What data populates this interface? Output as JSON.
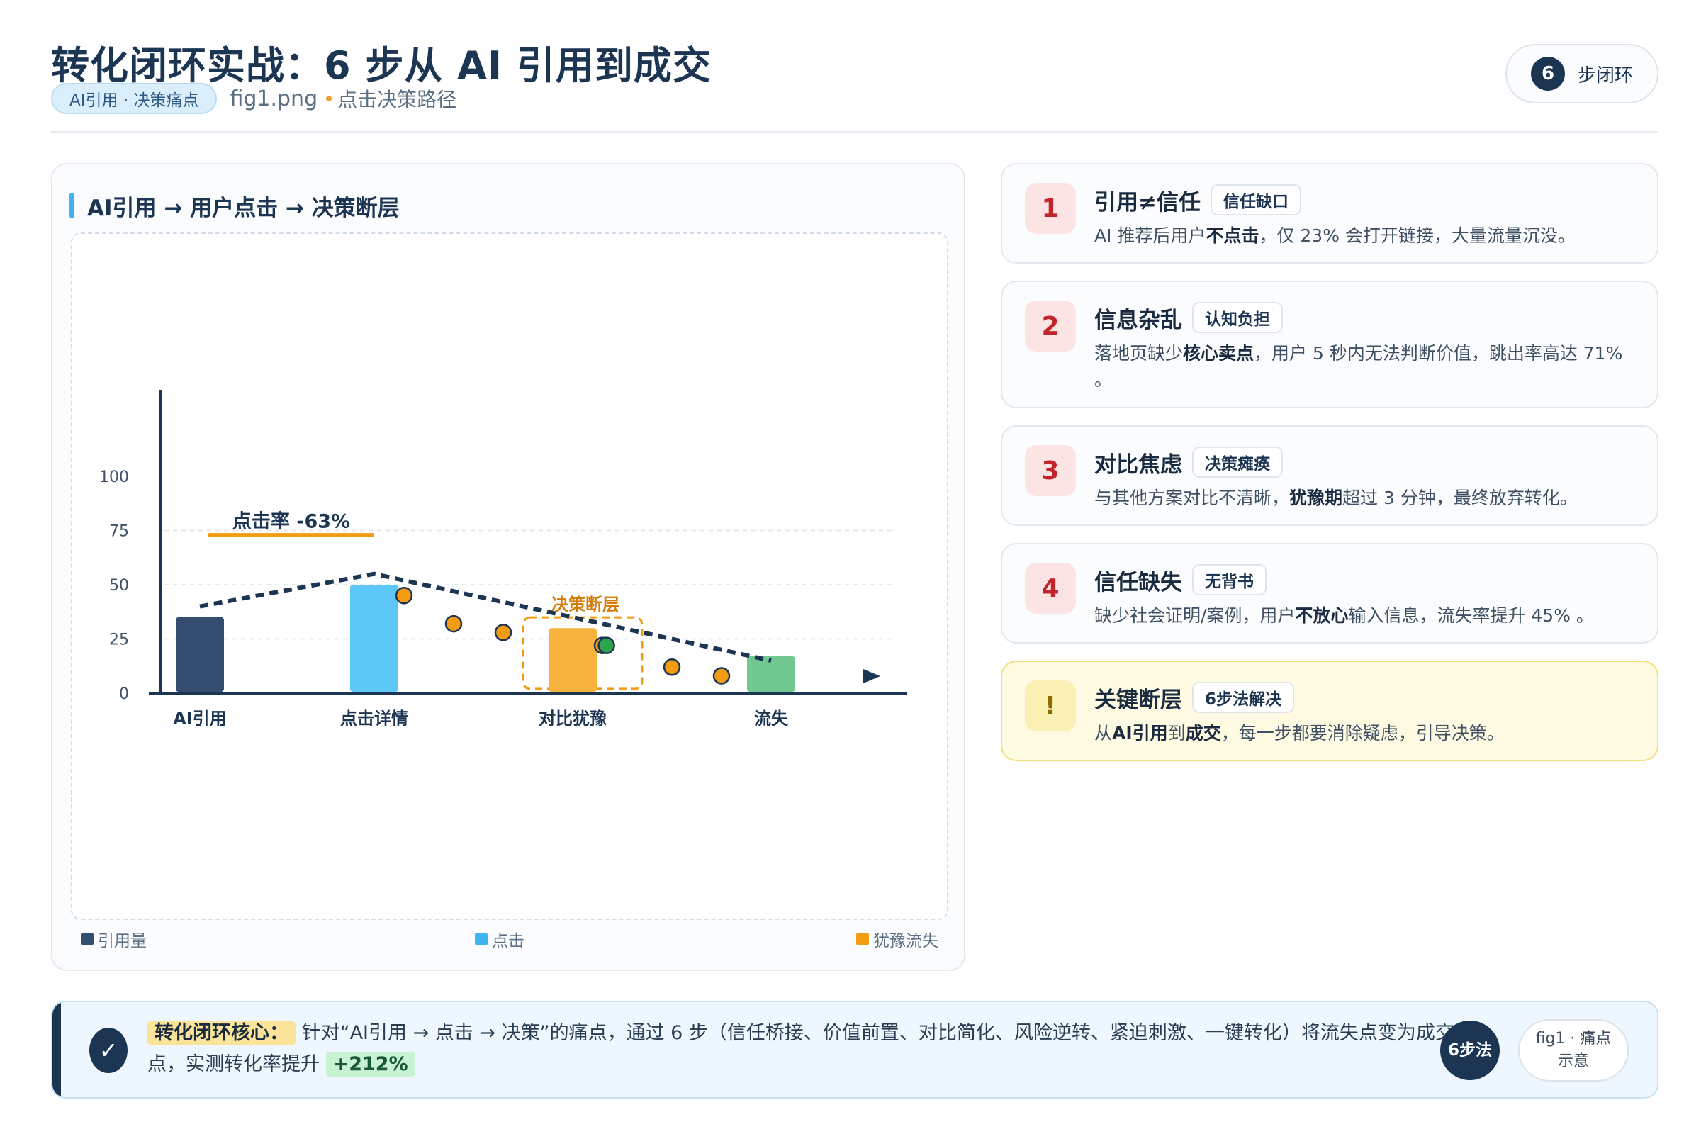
{
  "header": {
    "title": "转化闭环实战：6 步从 AI 引用到成交",
    "tag": "AI引用 · 决策痛点",
    "fig_name": "fig1.png",
    "fig_caption": "点击决策路径",
    "steps_number": "6",
    "steps_label": "步闭环"
  },
  "chart_card": {
    "title": "AI引用 → 用户点击 → 决策断层"
  },
  "chart_data": {
    "type": "bar",
    "categories": [
      "AI引用",
      "点击详情",
      "对比犹豫",
      "流失"
    ],
    "values": [
      35,
      50,
      30,
      17
    ],
    "bar_colors": [
      "#344d6e",
      "#5dc8f7",
      "#f8b23e",
      "#72c990"
    ],
    "ylim": [
      0,
      100
    ],
    "yticks": [
      0,
      25,
      50,
      75,
      100
    ],
    "trend_line": [
      [
        0,
        40
      ],
      [
        1,
        55
      ],
      [
        3,
        15
      ]
    ],
    "scatter_points": [
      [
        1.15,
        45
      ],
      [
        1.4,
        32
      ],
      [
        1.65,
        28
      ],
      [
        2.15,
        22
      ],
      [
        2.5,
        12
      ],
      [
        2.75,
        8
      ]
    ],
    "highlight_point": [
      2.17,
      22
    ],
    "annotations": {
      "click_rate": "点击率 -63%",
      "decision_gap": "决策断层"
    },
    "legend": [
      {
        "label": "引用量",
        "color": "#344d6e"
      },
      {
        "label": "点击",
        "color": "#3fb5f0"
      },
      {
        "label": "犹豫流失",
        "color": "#f39c12"
      }
    ],
    "grid": true,
    "legend_position": "bottom"
  },
  "cards": [
    {
      "number": "1",
      "title": "引用≠信任",
      "badge": "信任缺口",
      "desc_html": "AI 推荐后用户<b>不点击</b>，仅 23% 会打开链接，大量流量沉没。"
    },
    {
      "number": "2",
      "title": "信息杂乱",
      "badge": "认知负担",
      "desc_html": "落地页缺少<b>核心卖点</b>，用户 5 秒内无法判断价值，跳出率高达 71% 。"
    },
    {
      "number": "3",
      "title": "对比焦虑",
      "badge": "决策瘫痪",
      "desc_html": "与其他方案对比不清晰，<b>犹豫期</b>超过 3 分钟，最终放弃转化。"
    },
    {
      "number": "4",
      "title": "信任缺失",
      "badge": "无背书",
      "desc_html": "缺少社会证明/案例，用户<b>不放心</b>输入信息，流失率提升 45% 。"
    },
    {
      "number": "!",
      "title": "关键断层",
      "badge": "6步法解决",
      "desc_html": "从<b>AI引用</b>到<b>成交</b>，每一步都要消除疑虑，引导决策。"
    }
  ],
  "banner": {
    "check": "✓",
    "core_label": "转化闭环核心：",
    "text": "针对“AI引用 → 点击 → 决策”的痛点，通过 6 步（信任桥接、价值前置、对比简化、风险逆转、紧迫刺激、一键转化）将流失点变为成交点，实测转化率提升",
    "improvement": "+212%",
    "pill_steps": "6步法",
    "pill_fig": "fig1 · 痛点示意"
  },
  "colors": {
    "navy": "#1c3553",
    "accent_blue": "#3fb5f0",
    "orange": "#f39c12",
    "red": "#c2242b",
    "green": "#2ea44f"
  }
}
